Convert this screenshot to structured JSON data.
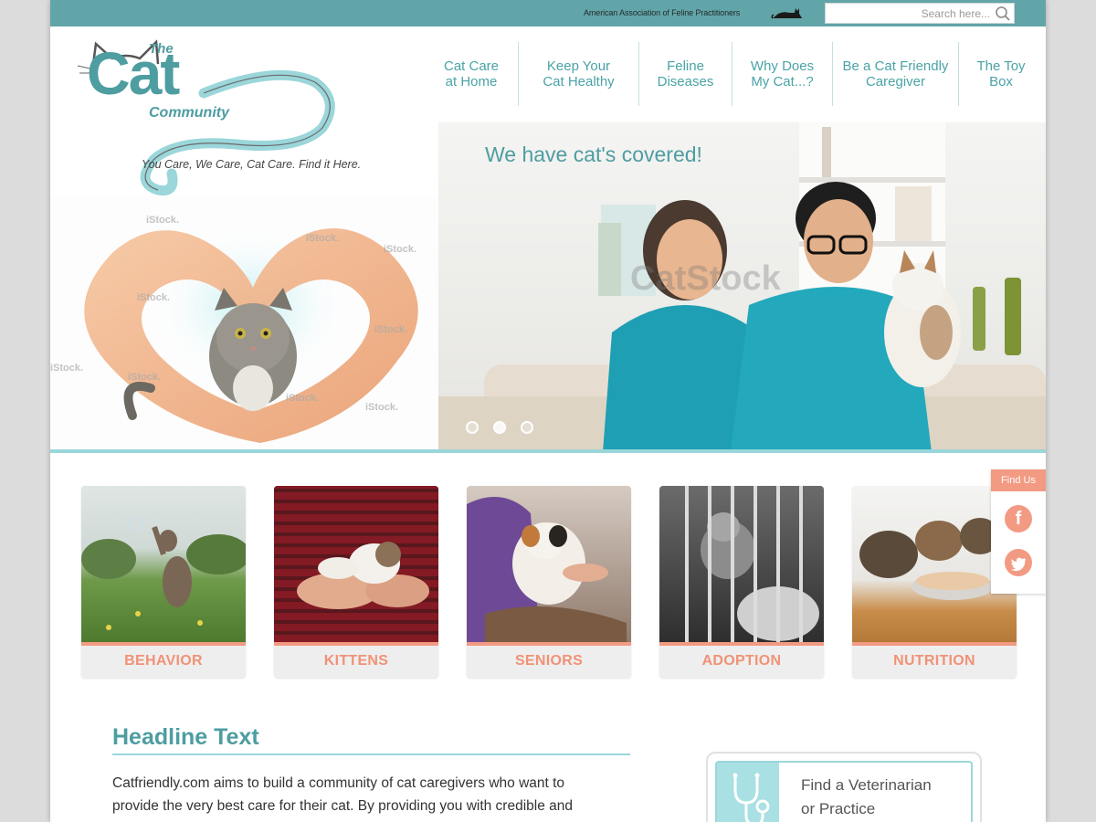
{
  "topbar": {
    "org_name": "American Association of Feline Practitioners",
    "org_logo_icon": "cat-silhouette-icon",
    "search_placeholder": "Search here...",
    "search_icon": "search-icon"
  },
  "logo": {
    "the": "The",
    "cat": "Cat",
    "community": "Community",
    "tagline": "You Care, We Care, Cat Care. Find it Here."
  },
  "nav": {
    "items": [
      {
        "line1": "Cat Care",
        "line2": "at Home"
      },
      {
        "line1": "Keep Your",
        "line2": "Cat Healthy"
      },
      {
        "line1": "Feline",
        "line2": "Diseases"
      },
      {
        "line1": "Why Does",
        "line2": "My Cat...?"
      },
      {
        "line1": "Be a Cat Friendly",
        "line2": "Caregiver"
      },
      {
        "line1": "The Toy",
        "line2": "Box"
      }
    ]
  },
  "hero": {
    "caption": "We have cat's covered!",
    "slides": 3,
    "active_slide": 1,
    "watermark_left": "iStock.",
    "watermark_right": "CatStock"
  },
  "categories": [
    {
      "label": "BEHAVIOR"
    },
    {
      "label": "KITTENS"
    },
    {
      "label": "SENIORS"
    },
    {
      "label": "ADOPTION"
    },
    {
      "label": "NUTRITION"
    }
  ],
  "findus": {
    "label": "Find Us",
    "facebook": "f",
    "twitter_icon": "twitter-icon"
  },
  "content": {
    "headline": "Headline Text",
    "body_line1": "Catfriendly.com aims to build a community of cat caregivers who want to",
    "body_line2": "provide the very best care for their cat. By providing you with credible and"
  },
  "vet_finder": {
    "line1": "Find a Veterinarian",
    "line2": "or Practice",
    "icon": "stethoscope-icon"
  },
  "colors": {
    "teal": "#62a5a9",
    "teal_text": "#4e9da1",
    "light_teal": "#9ad6da",
    "coral": "#f39a83"
  }
}
